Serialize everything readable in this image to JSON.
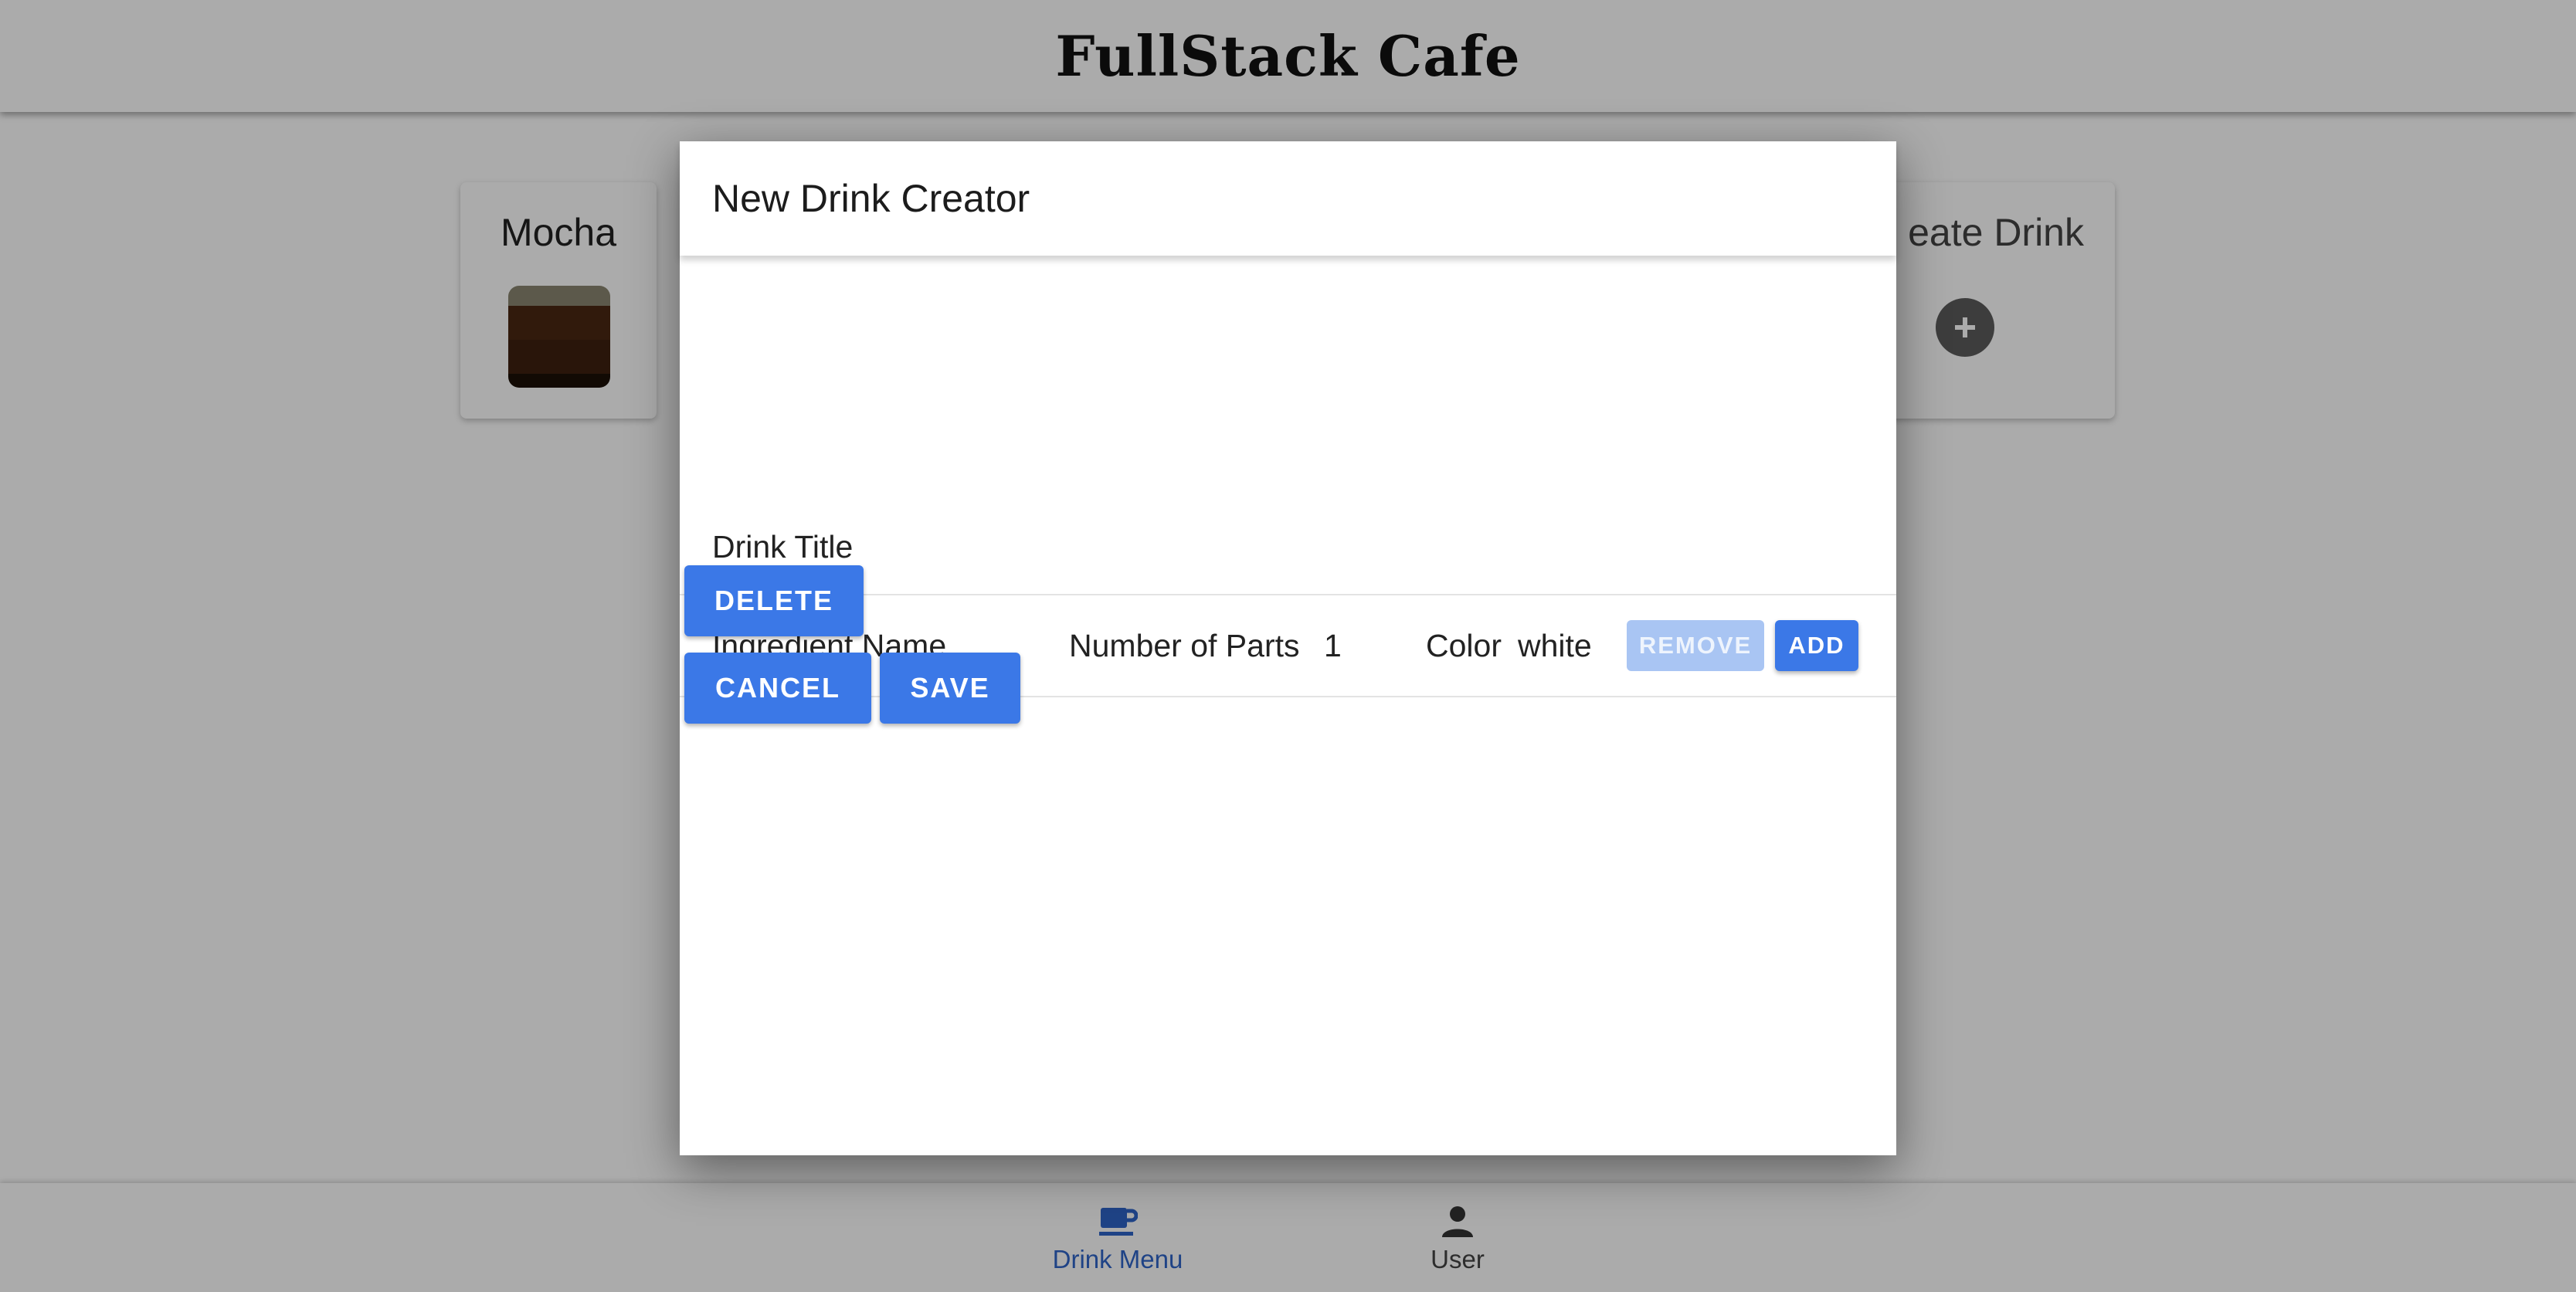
{
  "app": {
    "title": "FullStack Cafe"
  },
  "menu": {
    "cards": [
      {
        "title": "Mocha",
        "cup_layers": [
          "#8a8570",
          "#4a2712",
          "#3e200f",
          "#1b0f07"
        ]
      },
      {
        "title": "eate Drink"
      }
    ]
  },
  "modal": {
    "title": "New Drink Creator",
    "drink_title_label": "Drink Title",
    "drink_title_value": "",
    "ingredient": {
      "name_label": "Ingredient Name",
      "name_value": "",
      "parts_label": "Number of Parts",
      "parts_value": "1",
      "color_label": "Color",
      "color_value": "white"
    },
    "buttons": {
      "remove": "REMOVE",
      "add": "ADD",
      "delete": "DELETE",
      "cancel": "CANCEL",
      "save": "SAVE"
    }
  },
  "bottom_nav": {
    "items": [
      {
        "label": "Drink Menu",
        "icon": "coffee-cup-icon",
        "active": true
      },
      {
        "label": "User",
        "icon": "person-icon",
        "active": false
      }
    ]
  },
  "colors": {
    "accent": "#3b78e7",
    "accent_disabled": "#a9c5f3",
    "nav_active": "#2f64c8",
    "backdrop": "rgba(0,0,0,0.33)"
  }
}
